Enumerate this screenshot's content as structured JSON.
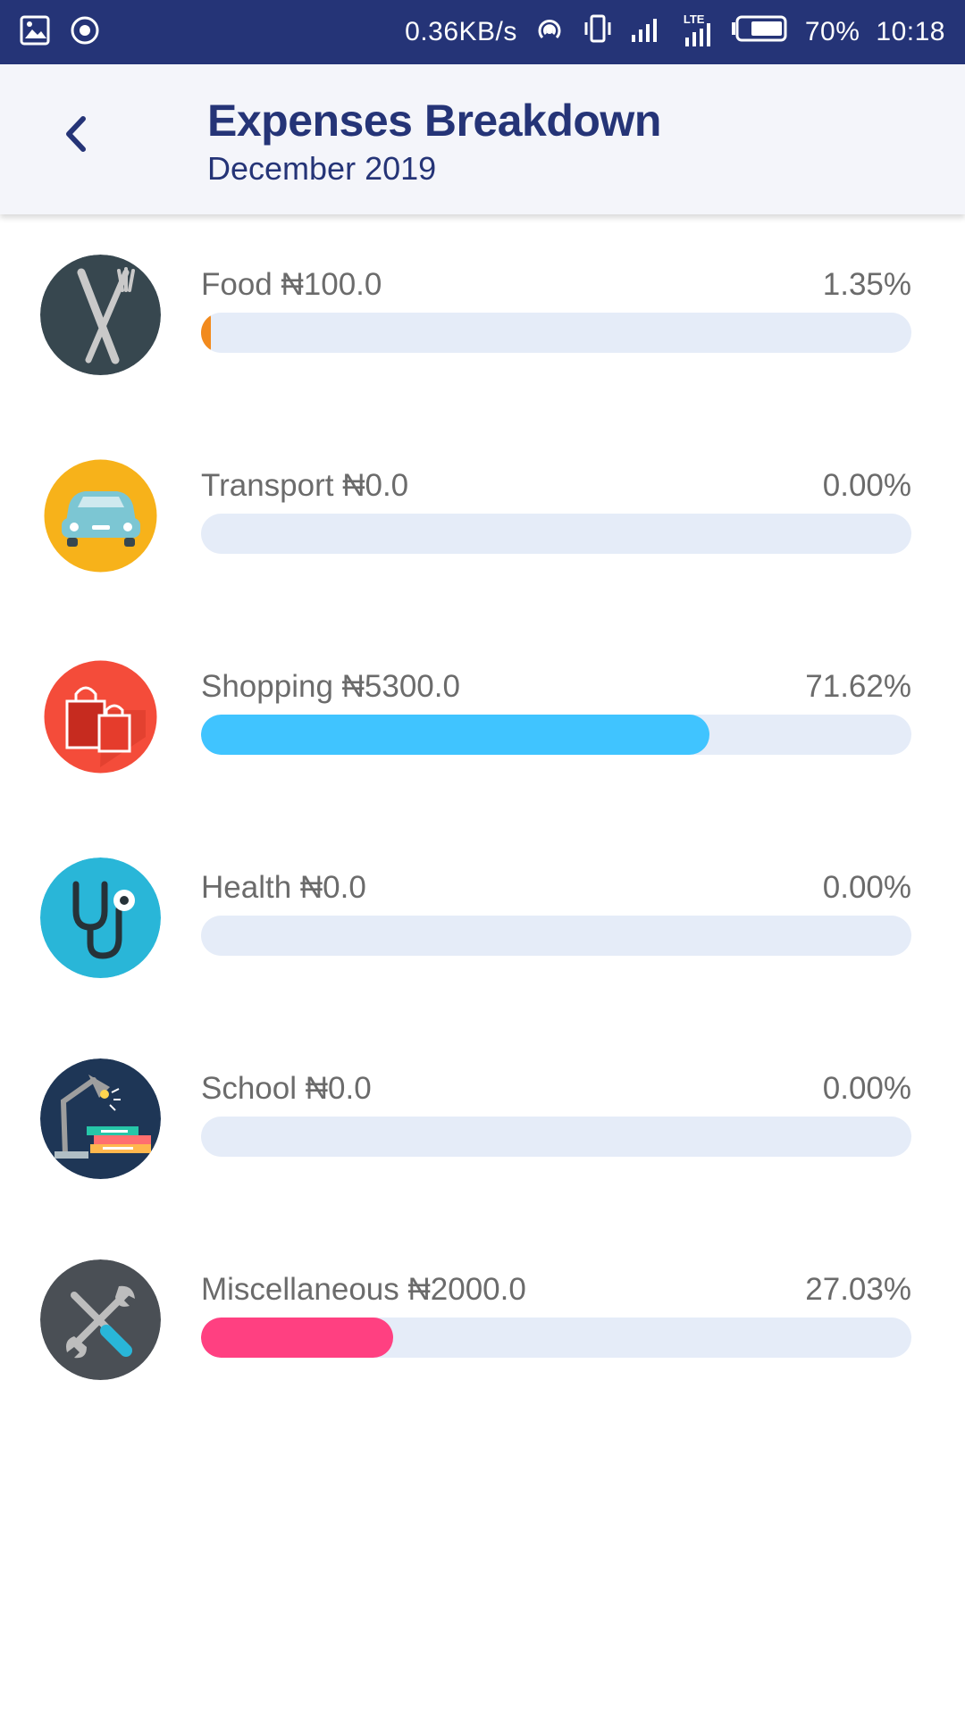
{
  "status_bar": {
    "network_speed": "0.36KB/s",
    "network_type": "LTE",
    "battery": "70%",
    "time": "10:18"
  },
  "header": {
    "title": "Expenses Breakdown",
    "subtitle": "December 2019"
  },
  "categories": [
    {
      "name": "Food",
      "label": "Food ₦100.0",
      "percent": "1.35%",
      "fraction": 0.0135,
      "min_fill": true,
      "color": "#f28a1d",
      "icon": "fork-knife-icon"
    },
    {
      "name": "Transport",
      "label": "Transport ₦0.0",
      "percent": "0.00%",
      "fraction": 0,
      "color": "#4fc3f7",
      "icon": "car-icon"
    },
    {
      "name": "Shopping",
      "label": "Shopping ₦5300.0",
      "percent": "71.62%",
      "fraction": 0.7162,
      "color": "#40c4ff",
      "icon": "shopping-bags-icon"
    },
    {
      "name": "Health",
      "label": "Health ₦0.0",
      "percent": "0.00%",
      "fraction": 0,
      "color": "#29b6d8",
      "icon": "stethoscope-icon"
    },
    {
      "name": "School",
      "label": "School ₦0.0",
      "percent": "0.00%",
      "fraction": 0,
      "color": "#2f4f7a",
      "icon": "desk-lamp-books-icon"
    },
    {
      "name": "Miscellaneous",
      "label": "Miscellaneous ₦2000.0",
      "percent": "27.03%",
      "fraction": 0.2703,
      "color": "#ff4081",
      "icon": "tools-icon"
    }
  ]
}
